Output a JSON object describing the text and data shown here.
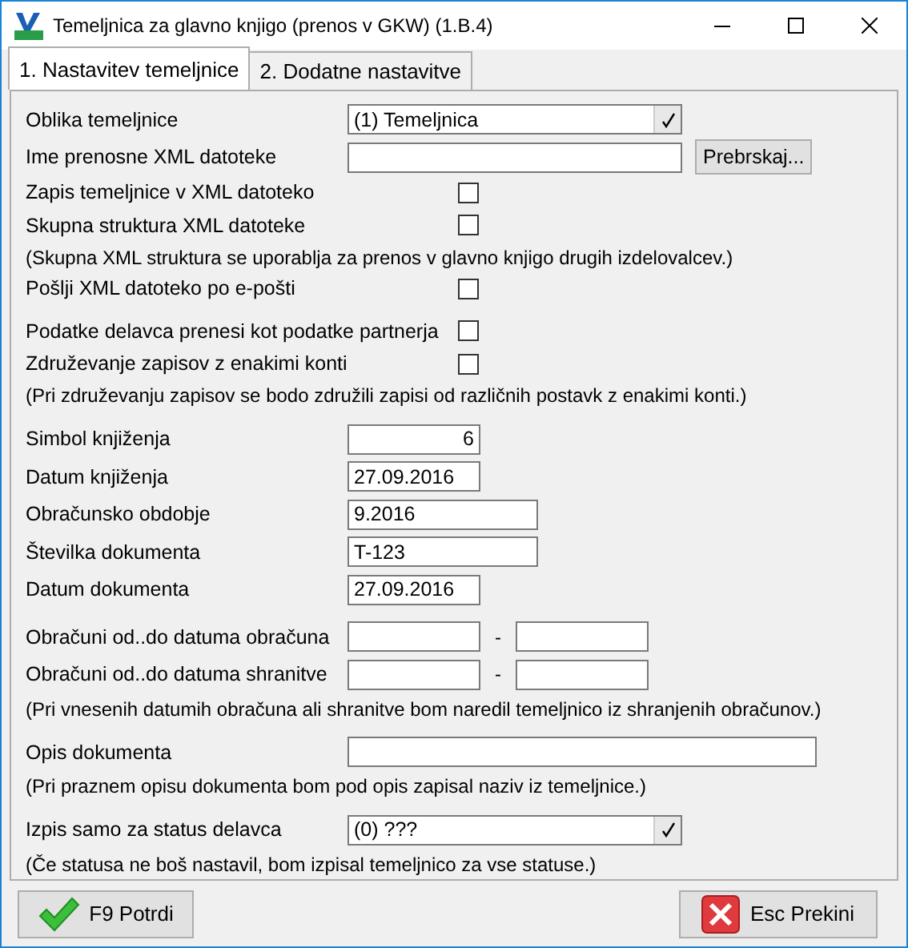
{
  "window": {
    "title": "Temeljnica za glavno knjigo (prenos v GKW)  (1.B.4)"
  },
  "tabs": [
    {
      "label": "1. Nastavitev temeljnice",
      "selected": true
    },
    {
      "label": "2. Dodatne nastavitve",
      "selected": false
    }
  ],
  "sections": [
    [
      {
        "kind": "combo",
        "label": "Oblika temeljnice",
        "value": "(1) Temeljnica"
      },
      {
        "kind": "browse",
        "label": "Ime prenosne XML datoteke",
        "button": "Prebrskaj..."
      },
      {
        "kind": "checkbox",
        "label": "Zapis temeljnice v XML datoteko",
        "checked": false
      },
      {
        "kind": "checkbox",
        "label": "Skupna struktura XML datoteke",
        "checked": false
      },
      {
        "kind": "note",
        "text": "(Skupna XML struktura se uporablja za prenos v glavno knjigo drugih izdelovalcev.)"
      },
      {
        "kind": "checkbox",
        "label": "Pošlji XML datoteko po e-pošti",
        "checked": false
      }
    ],
    [
      {
        "kind": "checkbox",
        "label": "Podatke delavca prenesi kot podatke partnerja",
        "checked": false
      },
      {
        "kind": "checkbox",
        "label": "Združevanje zapisov z enakimi konti",
        "checked": false
      },
      {
        "kind": "note",
        "text": "(Pri združevanju zapisov se bodo združili zapisi od različnih postavk z enakimi konti.)"
      }
    ],
    [
      {
        "kind": "number",
        "label": "Simbol knjiženja",
        "value": "6"
      },
      {
        "kind": "date",
        "label": "Datum knjiženja",
        "value": "27.09.2016"
      },
      {
        "kind": "text",
        "label": "Obračunsko obdobje",
        "value": "9.2016"
      },
      {
        "kind": "text",
        "label": "Številka dokumenta",
        "value": "T-123"
      },
      {
        "kind": "date",
        "label": "Datum dokumenta",
        "value": "27.09.2016"
      }
    ],
    [
      {
        "kind": "range",
        "label": "Obračuni od..do datuma obračuna",
        "separator": "-"
      },
      {
        "kind": "range",
        "label": "Obračuni od..do datuma shranitve",
        "separator": "-"
      },
      {
        "kind": "note",
        "text": "(Pri vnesenih datumih obračuna ali shranitve bom naredil temeljnico iz shranjenih obračunov.)"
      }
    ],
    [
      {
        "kind": "wide",
        "label": "Opis dokumenta"
      },
      {
        "kind": "note",
        "text": "(Pri praznem opisu dokumenta bom pod opis zapisal naziv iz temeljnice.)"
      }
    ],
    [
      {
        "kind": "combo",
        "label": "Izpis samo za status delavca",
        "value": "(0) ???"
      },
      {
        "kind": "note",
        "text": "(Če statusa ne boš nastavil, bom izpisal temeljnico za vse statuse.)"
      }
    ]
  ],
  "buttons": [
    {
      "kind": "confirm",
      "label": "F9 Potrdi"
    },
    {
      "kind": "cancel",
      "label": "Esc Prekini"
    }
  ]
}
